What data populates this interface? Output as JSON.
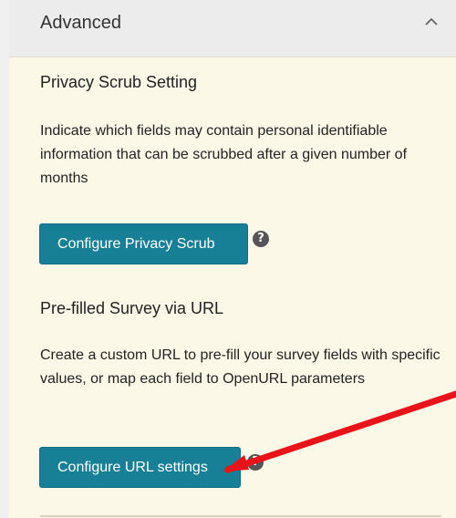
{
  "accordion": {
    "title": "Advanced",
    "chevron_icon": "chevron-up-icon"
  },
  "privacy_scrub": {
    "heading": "Privacy Scrub Setting",
    "description": "Indicate which fields may contain personal identifiable information that can be scrubbed after a given number of months",
    "button_label": "Configure Privacy Scrub",
    "help_icon": "?"
  },
  "prefilled_survey": {
    "heading": "Pre-filled Survey via URL",
    "description": "Create a custom URL to pre-fill your survey fields with specific values, or map each field to OpenURL parameters",
    "button_label": "Configure URL settings",
    "help_icon": "?"
  },
  "colors": {
    "button_bg": "#177f96",
    "panel_bg": "#fcf8e8",
    "header_bg": "#ececec",
    "annotation_arrow": "#e8141a"
  }
}
